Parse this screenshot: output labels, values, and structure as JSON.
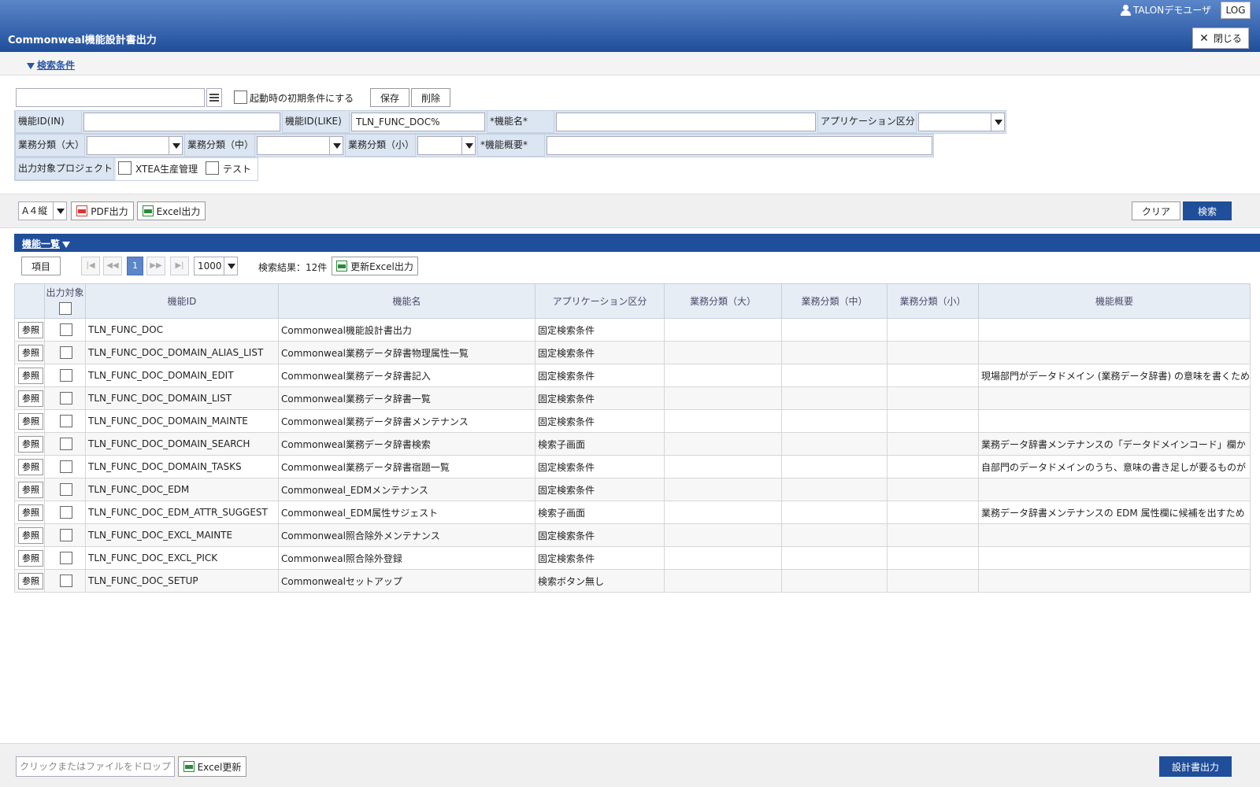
{
  "header": {
    "user_name": "TALONデモユーザ",
    "logout_label": "LOG",
    "app_title": "Commonweal機能設計書出力",
    "close_label": "閉じる"
  },
  "conditions": {
    "toggle_label": "検索条件",
    "saved_name_value": "",
    "startup_default_label": "起動時の初期条件にする",
    "save_label": "保存",
    "delete_label": "削除",
    "func_id_in_label": "機能ID(IN)",
    "func_id_in_value": "",
    "func_id_like_label": "機能ID(LIKE)",
    "func_id_like_value": "TLN_FUNC_DOC%",
    "func_name_label": "*機能名*",
    "func_name_value": "",
    "app_class_label": "アプリケーション区分",
    "app_class_value": "",
    "biz_large_label": "業務分類（大）",
    "biz_large_value": "",
    "biz_mid_label": "業務分類（中）",
    "biz_mid_value": "",
    "biz_small_label": "業務分類（小）",
    "biz_small_value": "",
    "func_summary_label": "*機能概要*",
    "func_summary_value": "",
    "project_label": "出力対象プロジェクト",
    "project_options": [
      "XTEA生産管理",
      "テスト"
    ]
  },
  "toolbar": {
    "paper_value": "A４縦",
    "pdf_label": "PDF出力",
    "excel_label": "Excel出力",
    "clear_label": "クリア",
    "search_label": "検索"
  },
  "list": {
    "title": "機能一覧",
    "columns_button": "項目",
    "current_page": "1",
    "page_size": "1000",
    "result_text": "検索結果：12件",
    "update_excel_label": "更新Excel出力",
    "headers": {
      "output": "出力対象",
      "func_id": "機能ID",
      "func_name": "機能名",
      "app_class": "アプリケーション区分",
      "biz_large": "業務分類（大）",
      "biz_mid": "業務分類（中）",
      "biz_small": "業務分類（小）",
      "summary": "機能概要"
    },
    "ref_label": "参照",
    "rows": [
      {
        "id": "TLN_FUNC_DOC",
        "name": "Commonweal機能設計書出力",
        "app": "固定検索条件",
        "summary": ""
      },
      {
        "id": "TLN_FUNC_DOC_DOMAIN_ALIAS_LIST",
        "name": "Commonweal業務データ辞書物理属性一覧",
        "app": "固定検索条件",
        "summary": ""
      },
      {
        "id": "TLN_FUNC_DOC_DOMAIN_EDIT",
        "name": "Commonweal業務データ辞書記入",
        "app": "固定検索条件",
        "summary": "現場部門がデータドメイン (業務データ辞書) の意味を書くため"
      },
      {
        "id": "TLN_FUNC_DOC_DOMAIN_LIST",
        "name": "Commonweal業務データ辞書一覧",
        "app": "固定検索条件",
        "summary": ""
      },
      {
        "id": "TLN_FUNC_DOC_DOMAIN_MAINTE",
        "name": "Commonweal業務データ辞書メンテナンス",
        "app": "固定検索条件",
        "summary": ""
      },
      {
        "id": "TLN_FUNC_DOC_DOMAIN_SEARCH",
        "name": "Commonweal業務データ辞書検索",
        "app": "検索子画面",
        "summary": "業務データ辞書メンテナンスの「データドメインコード」欄か"
      },
      {
        "id": "TLN_FUNC_DOC_DOMAIN_TASKS",
        "name": "Commonweal業務データ辞書宿題一覧",
        "app": "固定検索条件",
        "summary": "自部門のデータドメインのうち、意味の書き足しが要るものが"
      },
      {
        "id": "TLN_FUNC_DOC_EDM",
        "name": "Commonweal_EDMメンテナンス",
        "app": "固定検索条件",
        "summary": ""
      },
      {
        "id": "TLN_FUNC_DOC_EDM_ATTR_SUGGEST",
        "name": "Commonweal_EDM属性サジェスト",
        "app": "検索子画面",
        "summary": "業務データ辞書メンテナンスの EDM 属性欄に候補を出すため"
      },
      {
        "id": "TLN_FUNC_DOC_EXCL_MAINTE",
        "name": "Commonweal照合除外メンテナンス",
        "app": "固定検索条件",
        "summary": ""
      },
      {
        "id": "TLN_FUNC_DOC_EXCL_PICK",
        "name": "Commonweal照合除外登録",
        "app": "固定検索条件",
        "summary": ""
      },
      {
        "id": "TLN_FUNC_DOC_SETUP",
        "name": "Commonwealセットアップ",
        "app": "検索ボタン無し",
        "summary": ""
      }
    ]
  },
  "footer": {
    "drop_placeholder": "クリックまたはファイルをドロップ",
    "excel_update_label": "Excel更新",
    "design_output_label": "設計書出力"
  }
}
